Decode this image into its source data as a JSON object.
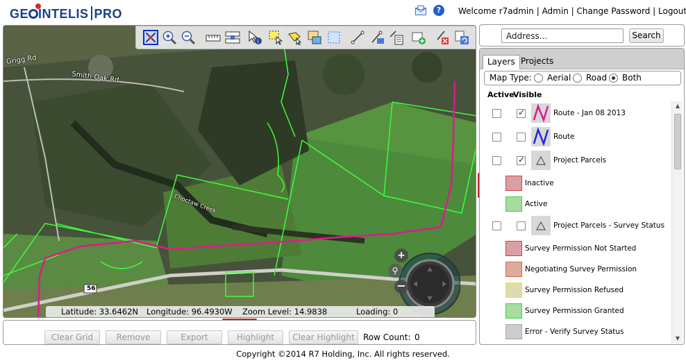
{
  "header": {
    "logo_main": "GE",
    "logo_rest": "INTELIS",
    "logo_pro": "PRO",
    "welcome": "Welcome r7admin",
    "links": [
      "Admin",
      "Change Password",
      "Logout"
    ]
  },
  "map": {
    "labels": {
      "grigg_rd": "Grigg Rd",
      "smith_oak_rd": "Smith Oak Rd",
      "choctaw_creek": "Choctaw Creek",
      "road_shield": "56"
    },
    "status": {
      "latitude": "Latitude: 33.6462N",
      "longitude": "Longitude: 96.4930W",
      "zoom_level": "Zoom Level: 14.9838",
      "loading": "Loading: 0"
    },
    "nav": {
      "zoom_in": "+",
      "zoom_out": "−"
    }
  },
  "grid": {
    "buttons": [
      "Clear Grid",
      "Remove",
      "Export",
      "Highlight",
      "Clear Highlight"
    ],
    "row_count_label": "Row Count:",
    "row_count_value": "0"
  },
  "search": {
    "placeholder": "Address...",
    "button": "Search"
  },
  "panel": {
    "tabs": [
      "Layers",
      "Projects"
    ],
    "map_type_label": "Map Type:",
    "map_types": [
      "Aerial",
      "Road",
      "Both"
    ],
    "map_type_selected": "Both",
    "col_active": "Active",
    "col_visible": "Visible",
    "layers": [
      {
        "name": "Route - Jan 08 2013",
        "active": false,
        "visible": true,
        "color": "#e0198c"
      },
      {
        "name": "Route",
        "active": false,
        "visible": false,
        "color": "#1a2bd6"
      },
      {
        "name": "Project Parcels",
        "active": false,
        "visible": true,
        "color": "#777777"
      },
      {
        "name": "Inactive",
        "legend": true,
        "fill": "#d9a0a4",
        "border": "#d84040"
      },
      {
        "name": "Active",
        "legend": true,
        "fill": "#a8dca0",
        "border": "#3cd63c"
      },
      {
        "name": "Project Parcels - Survey Status",
        "active": false,
        "visible": false,
        "color": "#777777"
      },
      {
        "name": "Survey Permission Not Started",
        "legend": true,
        "fill": "#d9a0a4",
        "border": "#d84040"
      },
      {
        "name": "Negotiating Survey Permission",
        "legend": true,
        "fill": "#dcaca0",
        "border": "#e06040"
      },
      {
        "name": "Survey Permission Refused",
        "legend": true,
        "fill": "#dcdcb0",
        "border": "#e8e040"
      },
      {
        "name": "Survey Permission Granted",
        "legend": true,
        "fill": "#a8dca0",
        "border": "#3cd63c"
      },
      {
        "name": "Error - Verify Survey Status",
        "legend": true,
        "fill": "#cccccc",
        "border": "#aaaaaa"
      }
    ]
  },
  "footer": "Copyright ©2014 R7 Holding, Inc. All rights reserved."
}
